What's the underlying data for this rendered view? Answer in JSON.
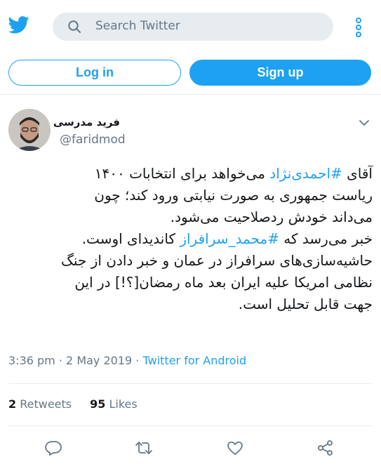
{
  "header": {
    "logo_icon": "twitter-bird-icon",
    "search_placeholder": "Search Twitter",
    "more_icon": "more-vertical-icon"
  },
  "auth": {
    "login_label": "Log in",
    "signup_label": "Sign up"
  },
  "tweet": {
    "author_name": "فرید مدرسی",
    "author_handle": "@faridmod",
    "lines": [
      {
        "before": "آقای ",
        "tag": "#احمدی‌نژاد",
        "after": " می‌خواهد برای انتخابات ۱۴۰۰"
      },
      {
        "text": "ریاست جمهوری به صورت نیابتی ورود کند؛ چون"
      },
      {
        "text": "می‌داند خودش ردصلاحیت می‌شود."
      },
      {
        "before": "خبر می‌رسد که ",
        "tag": "#محمد_سرافراز",
        "after": " کاندیدای اوست."
      },
      {
        "text": "حاشیه‌سازی‌های سرافراز در عمان و خبر دادن از جنگ"
      },
      {
        "text": "نظامی امریکا علیه ایران بعد ماه رمضان[؟!] در این"
      },
      {
        "text": "جهت قابل تحلیل است."
      }
    ],
    "time": "3:36 pm",
    "separator": "·",
    "date": "2 May 2019",
    "source": "Twitter for Android",
    "retweet_count": "2",
    "retweet_label": "Retweets",
    "like_count": "95",
    "like_label": "Likes"
  },
  "colors": {
    "accent": "#1da1f2",
    "muted_text": "#657786",
    "divider": "#e6ecf0"
  }
}
